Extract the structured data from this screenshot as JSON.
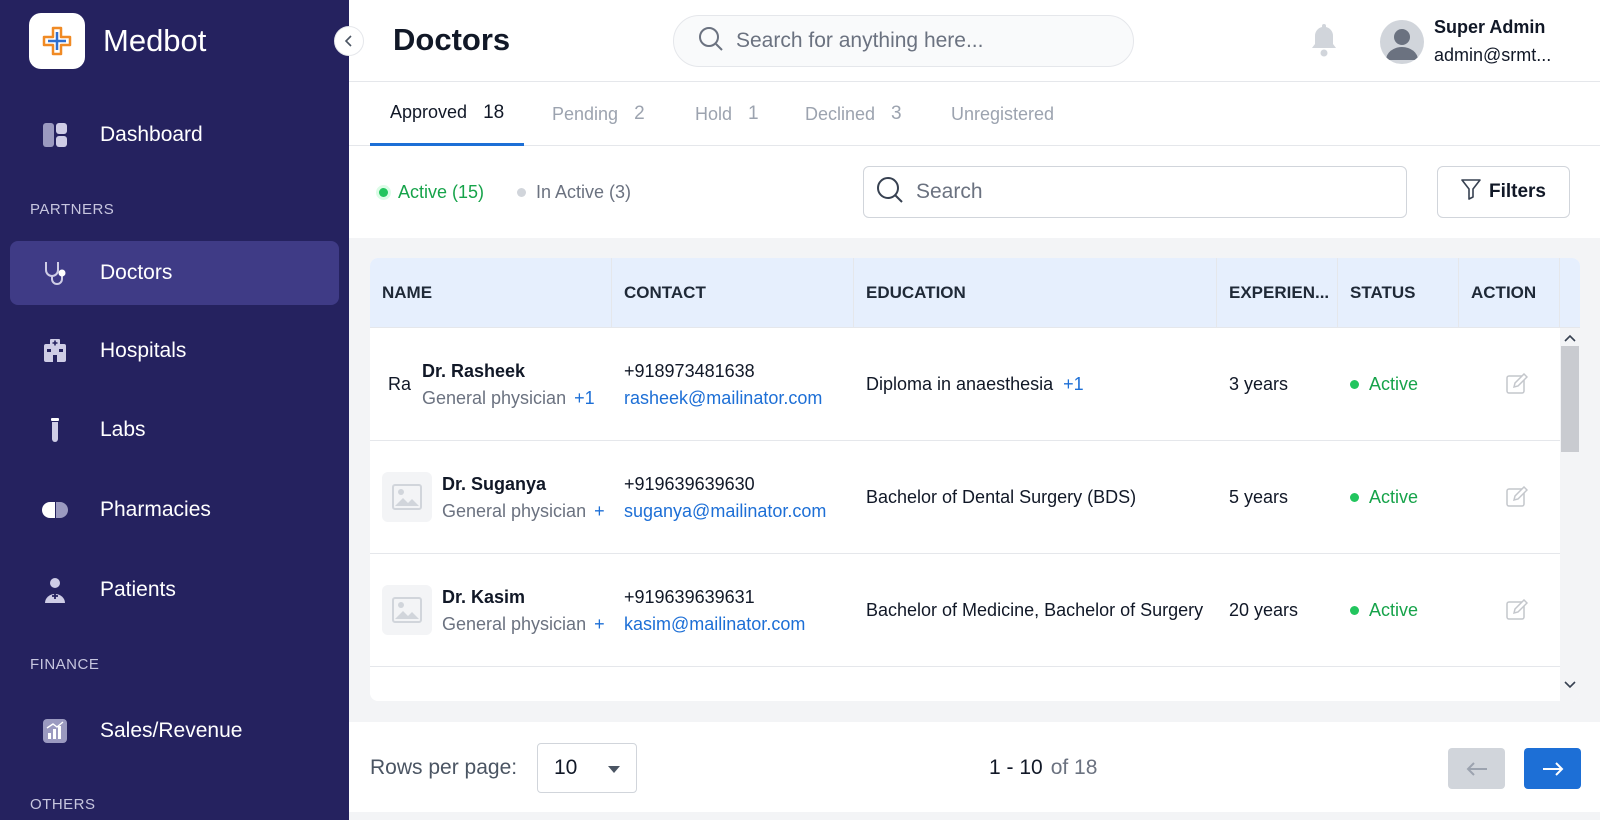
{
  "app": {
    "name": "Medbot"
  },
  "sidebar": {
    "items": [
      {
        "label": "Dashboard"
      },
      {
        "label": "Doctors"
      },
      {
        "label": "Hospitals"
      },
      {
        "label": "Labs"
      },
      {
        "label": "Pharmacies"
      },
      {
        "label": "Patients"
      },
      {
        "label": "Sales/Revenue"
      }
    ],
    "sections": {
      "partners": "PARTNERS",
      "finance": "FINANCE",
      "others": "OTHERS"
    },
    "active_item": "Doctors",
    "bg_color": "#25225f",
    "active_color": "#3f3b86"
  },
  "header": {
    "title": "Doctors",
    "search_placeholder": "Search for anything here...",
    "user": {
      "name": "Super Admin",
      "email": "admin@srmt..."
    }
  },
  "tabs": [
    {
      "label": "Approved",
      "count": "18",
      "active": true
    },
    {
      "label": "Pending",
      "count": "2"
    },
    {
      "label": "Hold",
      "count": "1"
    },
    {
      "label": "Declined",
      "count": "3"
    },
    {
      "label": "Unregistered",
      "count": ""
    }
  ],
  "filters": {
    "active_label": "Active (15)",
    "inactive_label": "In Active (3)",
    "search_placeholder": "Search",
    "filters_label": "Filters"
  },
  "table": {
    "columns": [
      "NAME",
      "CONTACT",
      "EDUCATION",
      "EXPERIEN...",
      "STATUS",
      "ACTION"
    ],
    "rows": [
      {
        "initials": "Ra",
        "name": "Dr. Rasheek",
        "specialty": "General physician",
        "specialty_more": "+1",
        "phone": "+918973481638",
        "email": "rasheek@mailinator.com",
        "education": "Diploma in anaesthesia",
        "education_more": "+1",
        "experience": "3 years",
        "status": "Active"
      },
      {
        "initials": "",
        "name": "Dr. Suganya",
        "specialty": "General physician",
        "specialty_more": "+",
        "phone": "+919639639630",
        "email": "suganya@mailinator.com",
        "education": "Bachelor of Dental Surgery (BDS)",
        "education_more": "",
        "experience": "5 years",
        "status": "Active"
      },
      {
        "initials": "",
        "name": "Dr. Kasim",
        "specialty": "General physician",
        "specialty_more": "+",
        "phone": "+919639639631",
        "email": "kasim@mailinator.com",
        "education": "Bachelor of Medicine, Bachelor of Surgery",
        "education_more": "",
        "experience": "20 years",
        "status": "Active"
      }
    ]
  },
  "pagination": {
    "rows_label": "Rows per page:",
    "rows_value": "10",
    "range": "1 - 10",
    "of_total": "of 18"
  },
  "colors": {
    "accent": "#1d6fd6",
    "active_status": "#16a34a",
    "table_header_bg": "#e6effd"
  }
}
